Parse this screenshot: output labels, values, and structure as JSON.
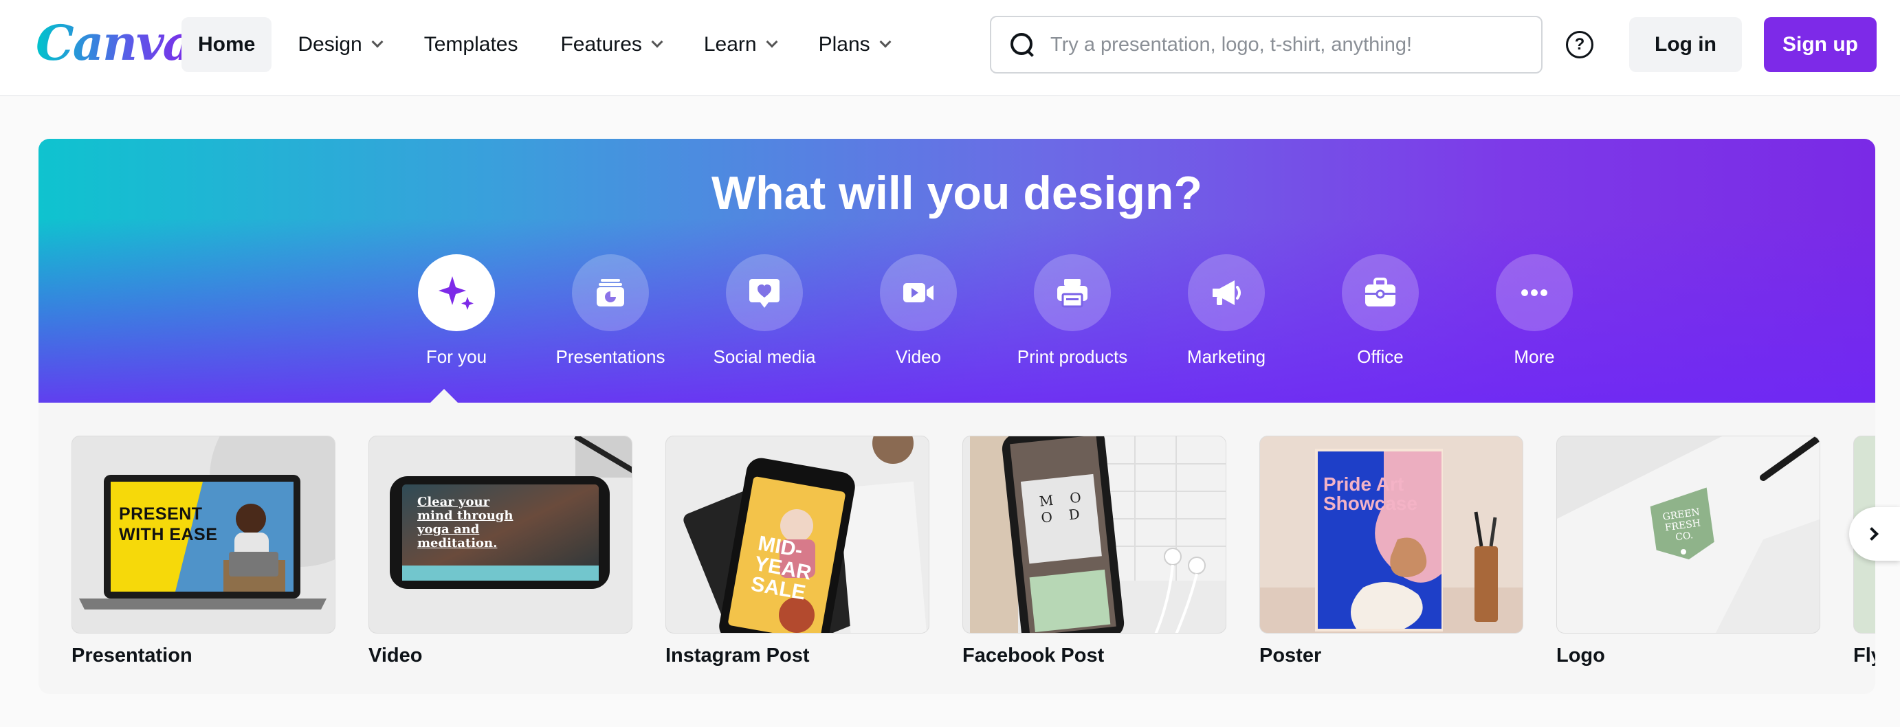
{
  "header": {
    "logo": "Canva",
    "nav": [
      {
        "label": "Home",
        "active": true,
        "dropdown": false
      },
      {
        "label": "Design",
        "active": false,
        "dropdown": true
      },
      {
        "label": "Templates",
        "active": false,
        "dropdown": false
      },
      {
        "label": "Features",
        "active": false,
        "dropdown": true
      },
      {
        "label": "Learn",
        "active": false,
        "dropdown": true
      },
      {
        "label": "Plans",
        "active": false,
        "dropdown": true
      }
    ],
    "search_placeholder": "Try a presentation, logo, t-shirt, anything!",
    "help_icon": "question-circle-icon",
    "login_label": "Log in",
    "signup_label": "Sign up"
  },
  "hero": {
    "title": "What will you design?",
    "categories": [
      {
        "label": "For you",
        "icon": "sparkle-icon",
        "active": true
      },
      {
        "label": "Presentations",
        "icon": "presentation-icon",
        "active": false
      },
      {
        "label": "Social media",
        "icon": "heart-chat-icon",
        "active": false
      },
      {
        "label": "Video",
        "icon": "video-camera-icon",
        "active": false
      },
      {
        "label": "Print products",
        "icon": "printer-icon",
        "active": false
      },
      {
        "label": "Marketing",
        "icon": "megaphone-icon",
        "active": false
      },
      {
        "label": "Office",
        "icon": "briefcase-icon",
        "active": false
      },
      {
        "label": "More",
        "icon": "more-dots-icon",
        "active": false
      }
    ]
  },
  "cards": [
    {
      "label": "Presentation",
      "thumb_text": "PRESENT WITH EASE"
    },
    {
      "label": "Video",
      "thumb_text": "Clear your mind through yoga and meditation."
    },
    {
      "label": "Instagram Post",
      "thumb_text": "MID-YEAR SALE"
    },
    {
      "label": "Facebook Post",
      "thumb_text": "MOOD"
    },
    {
      "label": "Poster",
      "thumb_text": "Pride Art Showcase"
    },
    {
      "label": "Logo",
      "thumb_text": "GREEN FRESH CO."
    },
    {
      "label": "Fly"
    }
  ],
  "colors": {
    "brand_purple": "#7d2ae8",
    "brand_teal": "#00c4cc"
  }
}
